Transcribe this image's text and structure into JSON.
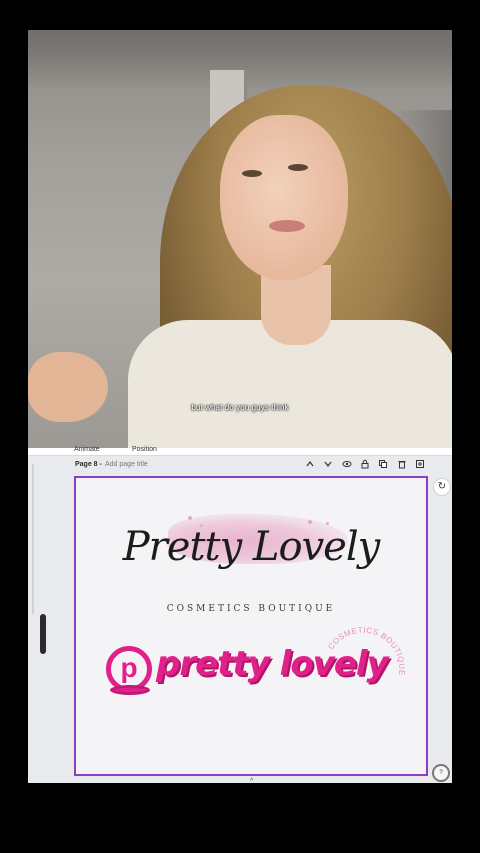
{
  "video": {
    "caption": "but what do you guys think"
  },
  "editor": {
    "toolbar": {
      "animate_label": "Animate",
      "position_label": "Position"
    },
    "page": {
      "label": "Page 8 -",
      "title_placeholder": "Add page title"
    },
    "page_tools": [
      "chevron-up-icon",
      "chevron-down-icon",
      "eye-icon",
      "lock-icon",
      "duplicate-icon",
      "delete-icon",
      "add-page-icon"
    ],
    "canvas": {
      "script_logo": "Pretty Lovely",
      "sub_logo": "COSMETICS BOUTIQUE",
      "pink_logo_text": "pretty lovely",
      "pink_logo_mark": "p",
      "arc_text": "COSMETICS BOUTIQUE"
    },
    "colors": {
      "selection_border": "#8b3fc1",
      "brand_pink": "#e0218a",
      "splash_pink": "#e8b0cc"
    }
  }
}
